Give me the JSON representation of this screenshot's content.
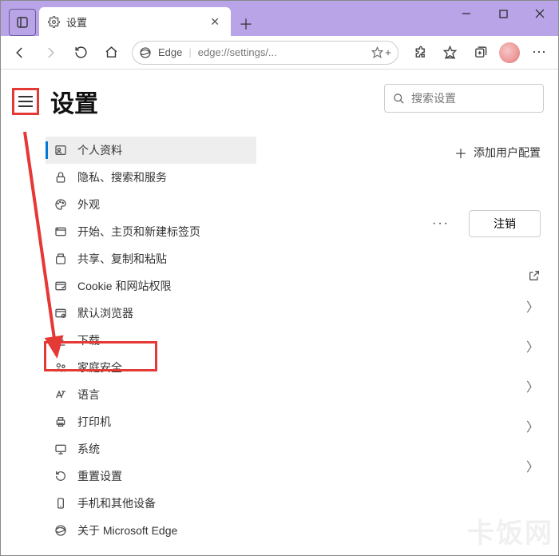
{
  "window": {
    "tab_title": "设置",
    "address_label": "Edge",
    "address_url": "edge://settings/..."
  },
  "page": {
    "title": "设置",
    "search_placeholder": "搜索设置"
  },
  "sidebar": {
    "items": [
      {
        "label": "个人资料",
        "icon": "profile-icon",
        "active": true
      },
      {
        "label": "隐私、搜索和服务",
        "icon": "lock-icon"
      },
      {
        "label": "外观",
        "icon": "appearance-icon"
      },
      {
        "label": "开始、主页和新建标签页",
        "icon": "home-tab-icon"
      },
      {
        "label": "共享、复制和粘贴",
        "icon": "share-icon"
      },
      {
        "label": "Cookie 和网站权限",
        "icon": "cookie-icon"
      },
      {
        "label": "默认浏览器",
        "icon": "browser-icon"
      },
      {
        "label": "下载",
        "icon": "download-icon"
      },
      {
        "label": "家庭安全",
        "icon": "family-icon"
      },
      {
        "label": "语言",
        "icon": "language-icon"
      },
      {
        "label": "打印机",
        "icon": "printer-icon"
      },
      {
        "label": "系统",
        "icon": "system-icon"
      },
      {
        "label": "重置设置",
        "icon": "reset-icon"
      },
      {
        "label": "手机和其他设备",
        "icon": "phone-icon"
      },
      {
        "label": "关于 Microsoft Edge",
        "icon": "edge-icon"
      }
    ]
  },
  "main": {
    "add_profile": "添加用户配置",
    "more": "···",
    "logout": "注销"
  },
  "watermark": "卡饭网"
}
